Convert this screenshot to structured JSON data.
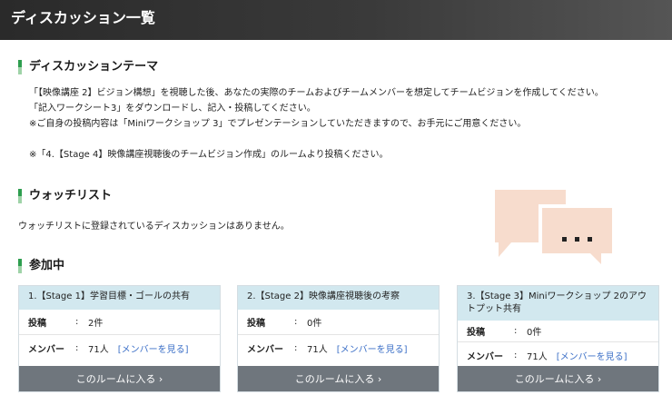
{
  "header": {
    "title": "ディスカッション一覧"
  },
  "theme": {
    "title": "ディスカッションテーマ",
    "lines": [
      "「【映像講座 2】ビジョン構想」を視聴した後、あなたの実際のチームおよびチームメンバーを想定してチームビジョンを作成してください。",
      "「記入ワークシート3」をダウンロードし、記入・投稿してください。",
      "※ご自身の投稿内容は「Miniワークショップ 3」でプレゼンテーションしていただきますので、お手元にご用意ください。",
      "※「4.【Stage 4】映像講座視聴後のチームビジョン作成」のルームより投稿ください。"
    ]
  },
  "watchlist": {
    "title": "ウォッチリスト",
    "empty_text": "ウォッチリストに登録されているディスカッションはありません。"
  },
  "participating": {
    "title": "参加中",
    "cards": [
      {
        "title": "1.【Stage 1】学習目標・ゴールの共有",
        "posts_label": "投稿",
        "colon": ":",
        "posts": "2件",
        "members_label": "メンバー",
        "members_colon": ":",
        "members": "71人",
        "members_link": "[メンバーを見る]",
        "button": "このルームに入る ›"
      },
      {
        "title": "2.【Stage 2】映像講座視聴後の考察",
        "posts_label": "投稿",
        "colon": ":",
        "posts": "0件",
        "members_label": "メンバー",
        "members_colon": ":",
        "members": "71人",
        "members_link": "[メンバーを見る]",
        "button": "このルームに入る ›"
      },
      {
        "title": "3.【Stage 3】Miniワークショップ 2のアウトプット共有",
        "posts_label": "投稿",
        "colon": ":",
        "posts": "0件",
        "members_label": "メンバー",
        "members_colon": ":",
        "members": "71人",
        "members_link": "[メンバーを見る]",
        "button": "このルームに入る ›"
      }
    ]
  },
  "colors": {
    "header_bg": "#2a2a2a",
    "accent_green": "#2e9e4f",
    "card_head": "#d2e8ef",
    "button_bg": "#6f767d",
    "link": "#3b6fc7",
    "bubble": "#f7dccd"
  },
  "icons": {
    "chat_art": "chat-bubbles-icon"
  }
}
